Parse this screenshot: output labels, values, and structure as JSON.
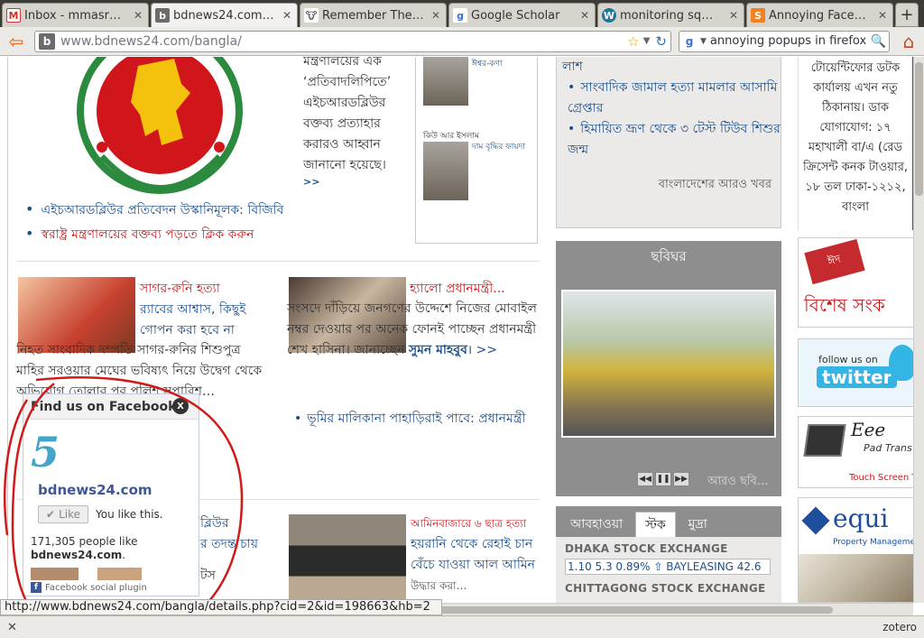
{
  "tabs": [
    {
      "label": "Inbox - mmasr…",
      "icon": "gmail-icon",
      "active": false
    },
    {
      "label": "bdnews24.com…",
      "icon": "bdnews-icon",
      "active": true
    },
    {
      "label": "Remember The…",
      "icon": "rtm-icon",
      "active": false
    },
    {
      "label": "Google Scholar",
      "icon": "google-icon",
      "active": false
    },
    {
      "label": "monitoring sq…",
      "icon": "wordpress-icon",
      "active": false
    },
    {
      "label": "Annoying Face…",
      "icon": "stackexchange-icon",
      "active": false
    }
  ],
  "nav": {
    "url": "www.bdnews24.com/bangla/",
    "search_value": "annoying popups in firefox"
  },
  "col1": {
    "lead_text": "মন্ত্রণালয়ের এক ‘প্রতিবাদলিপিতে’ এইচআরডব্লিউর বক্তব্য প্রত্যাহার করারও আহ্বান জানানো হয়েছে।",
    "more": ">>",
    "bullet1": "এইচআরডব্লিউর প্রতিবেদন উস্কানিমূলক: বিজিবি",
    "bullet2": "স্বরাষ্ট্র মন্ত্রণালয়ের বক্তব্য পড়তে ক্লিক করুন"
  },
  "opinion": {
    "author1_link": "ঈশ্বর-কণা",
    "author2": "কিউ আর ইসলাম",
    "author2_link": "দাম বৃদ্ধির ফায়দা"
  },
  "story_sagar": {
    "title": "সাগর-রুনি হত্যা",
    "headline": "র‌্যাবের আশ্বাস, কিছুই গোপন করা হবে না",
    "body": "নিহত সাংবাদিক দম্পতি সাগর-রুনির শিশুপুত্র মাহির সরওয়ার মেঘের ভবিষ্যৎ নিয়ে উদ্বেগ থেকে অভিযোগ তোলার পর পুলিশ সুপারিশ…"
  },
  "story_pm": {
    "title": "হ্যালো প্রধানমন্ত্রী...",
    "body": "সংসদে দাঁড়িয়ে জনগণের উদ্দেশে নিজের মোবাইল নম্বর দেওয়ার পর অনেক ফোনই পাচ্ছেন প্রধানমন্ত্রী শেখ হাসিনা। জানাচ্ছেন",
    "reporter": "সুমন মাহবুব",
    "more": "। >>",
    "bullet": "ভূমির মালিকানা পাহাড়িরাই পাবে: প্রধানমন্ত্রী"
  },
  "story_lower_left": {
    "line1": "ব্লিউর",
    "line2": "র তদন্ত চায়",
    "line3": "টস"
  },
  "story_amin": {
    "title": "আমিনবাজারে ৬ ছাত্র হত্যা",
    "headline": "হয়রানি থেকে রেহাই চান বেঁচে যাওয়া আল আমিন",
    "tail": "উদ্ধার করা…"
  },
  "newsbox": {
    "item0": "লাশ",
    "item1": "সাংবাদিক জামাল হত্যা মামলার আসামি গ্রেপ্তার",
    "item2": "হিমায়িত ভ্রূণ থেকে ৩ টেস্ট টিউব শিশুর জন্ম",
    "more": "বাংলাদেশের আরও খবর"
  },
  "gallery": {
    "title": "ছবিঘর",
    "more": "আরও ছবি..."
  },
  "market": {
    "tabs": [
      "আবহাওয়া",
      "স্টক",
      "মুদ্রা"
    ],
    "dhaka_header": "DHAKA STOCK EXCHANGE",
    "dhaka_value": "1.10 5.3 0.89% ⇧ BAYLEASING 42.6",
    "ctg_header": "CHITTAGONG STOCK EXCHANGE"
  },
  "sidebar": {
    "address": "টোয়েন্টিফোর ডটক কার্যালয় এখন নতু ঠিকানায়। ডাক যোগাযোগ: ১৭ মহাখালী বা/এ (রেড ক্রিসেন্ট কনক টাওয়ার, ১৮ তল ঢাকা-১২১২, বাংলা",
    "ad1_text": "বিশেষ সংক",
    "ad1_badge": "ঈদ",
    "ad2_small": "follow us on",
    "ad2_big": "twitter",
    "ad3_brand": "Eee",
    "ad3_model": "Pad Trans",
    "ad3_caption": "Touch Screen Ta",
    "ad4_brand": "equi",
    "ad4_sub": "Property Management"
  },
  "facebook": {
    "header": "Find us on Facebook",
    "close": "X",
    "page_name": "bdnews24.com",
    "like_button": "Like",
    "you_like": "You like this.",
    "count": "171,305 people like",
    "count_page": "bdnews24.com",
    "plugin": "Facebook social plugin"
  },
  "status": {
    "url": "http://www.bdnews24.com/bangla/details.php?cid=2&id=198663&hb=2"
  },
  "addonbar": {
    "close": "✕",
    "zotero": "zotero"
  },
  "colors": {
    "link_blue": "#1a4f8b",
    "headline_red": "#d0161b",
    "annotation_red": "#d11a1a"
  }
}
